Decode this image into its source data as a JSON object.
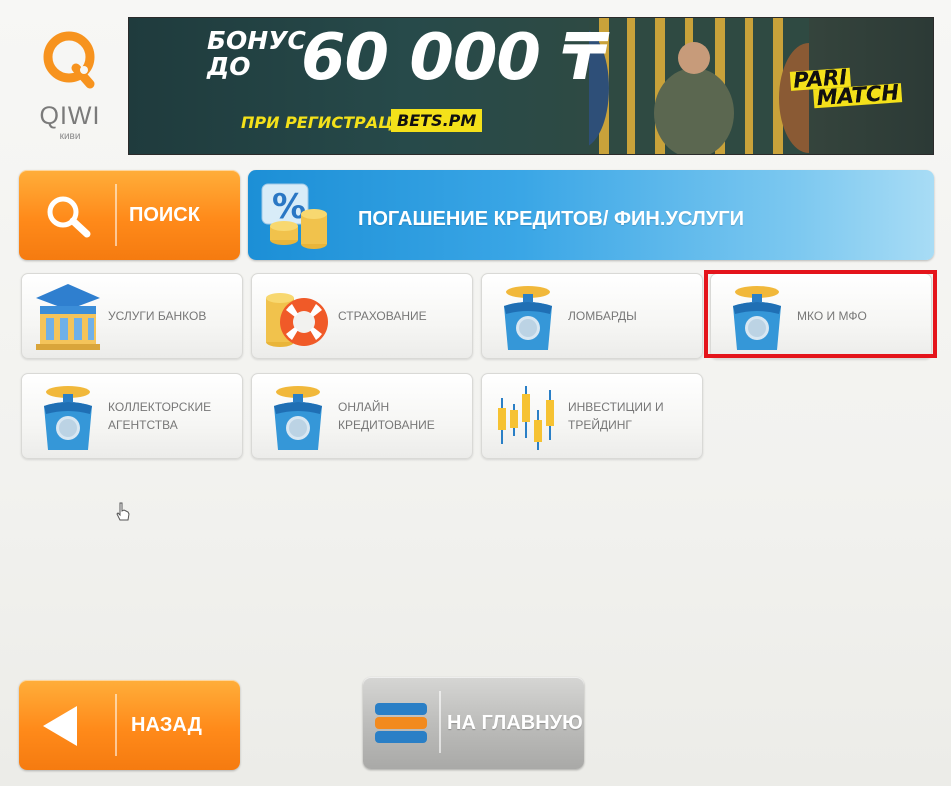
{
  "logo": {
    "text": "QIWI",
    "subtext": "киви",
    "color": "#f7931e"
  },
  "banner": {
    "bonus_text": "БОНУС ДО",
    "amount": "60 000 ₸",
    "registration_text": "ПРИ РЕГИСТРАЦИИ",
    "site": "BETS.PM",
    "brand_line1": "PARI",
    "brand_line2": "MATCH"
  },
  "search_button": {
    "label": "ПОИСК",
    "icon": "search-icon"
  },
  "category": {
    "title": "ПОГАШЕНИЕ КРЕДИТОВ/ ФИН.УСЛУГИ",
    "icon": "percent-coins-icon"
  },
  "tiles": [
    {
      "label": "УСЛУГИ БАНКОВ",
      "icon": "bank-icon"
    },
    {
      "label": "СТРАХОВАНИЕ",
      "icon": "lifebuoy-icon"
    },
    {
      "label": "ЛОМБАРДЫ",
      "icon": "scale-icon"
    },
    {
      "label": "МКО И МФО",
      "icon": "scale-icon"
    },
    {
      "label": "КОЛЛЕКТОРСКИЕ АГЕНТСТВА",
      "icon": "scale-icon"
    },
    {
      "label": "ОНЛАЙН КРЕДИТОВАНИЕ",
      "icon": "scale-icon"
    },
    {
      "label": "ИНВЕСТИЦИИ И ТРЕЙДИНГ",
      "icon": "candlestick-icon"
    }
  ],
  "back_button": {
    "label": "НАЗАД",
    "icon": "back-arrow-icon"
  },
  "home_button": {
    "label": "НА ГЛАВНУЮ",
    "icon": "home-stack-icon"
  },
  "colors": {
    "orange": "#ff8a1a",
    "blue": "#2b9be0",
    "highlight": "#e4141b"
  }
}
